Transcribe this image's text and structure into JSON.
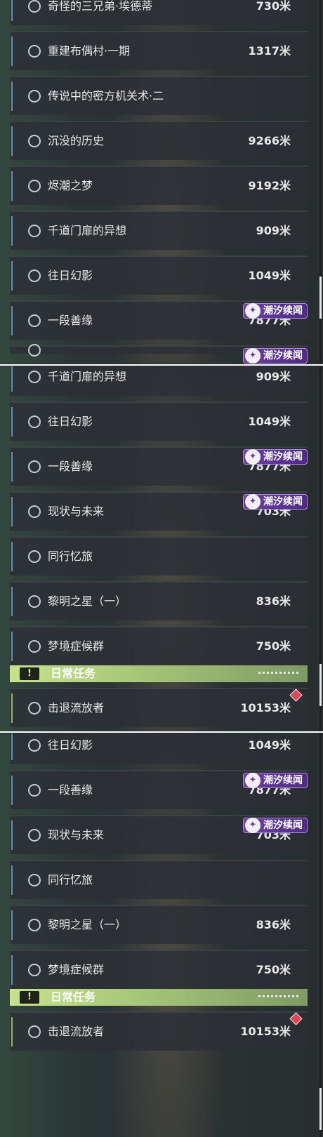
{
  "tag_label": "潮汐续闻",
  "daily_section": {
    "title": "日常任务",
    "badge": "!"
  },
  "panels": [
    {
      "rows": [
        {
          "name": "奇怪的三兄弟·埃德蒂",
          "distance": "730米",
          "tag": false,
          "partial": "top"
        },
        {
          "name": "重建布偶村·一期",
          "distance": "1317米",
          "tag": false
        },
        {
          "name": "传说中的密方机关术·二",
          "distance": "",
          "tag": false
        },
        {
          "name": "沉没的历史",
          "distance": "9266米",
          "tag": false
        },
        {
          "name": "烬潮之梦",
          "distance": "9192米",
          "tag": false
        },
        {
          "name": "千道门扉的异想",
          "distance": "909米",
          "tag": false
        },
        {
          "name": "往日幻影",
          "distance": "1049米",
          "tag": false
        },
        {
          "name": "一段善缘",
          "distance": "7877米",
          "tag": true
        },
        {
          "name": "",
          "distance": "",
          "tag": true,
          "partial": "bottom"
        }
      ],
      "scroll_position": 0.86
    },
    {
      "rows": [
        {
          "name": "千道门扉的异想",
          "distance": "909米",
          "tag": false
        },
        {
          "name": "往日幻影",
          "distance": "1049米",
          "tag": false
        },
        {
          "name": "一段善缘",
          "distance": "7877米",
          "tag": true
        },
        {
          "name": "现状与未来",
          "distance": "703米",
          "tag": true
        },
        {
          "name": "同行忆旅",
          "distance": "",
          "tag": false
        },
        {
          "name": "黎明之星（一）",
          "distance": "836米",
          "tag": false
        },
        {
          "name": "梦境症候群",
          "distance": "750米",
          "tag": false
        }
      ],
      "daily_rows": [
        {
          "name": "击退流放者",
          "distance": "10153米"
        }
      ],
      "scroll_position": 0.92
    },
    {
      "rows": [
        {
          "name": "往日幻影",
          "distance": "1049米",
          "tag": false
        },
        {
          "name": "一段善缘",
          "distance": "7877米",
          "tag": true
        },
        {
          "name": "现状与未来",
          "distance": "703米",
          "tag": true
        },
        {
          "name": "同行忆旅",
          "distance": "",
          "tag": false
        },
        {
          "name": "黎明之星（一）",
          "distance": "836米",
          "tag": false
        },
        {
          "name": "梦境症候群",
          "distance": "750米",
          "tag": false
        }
      ],
      "daily_rows": [
        {
          "name": "击退流放者",
          "distance": "10153米"
        }
      ],
      "scroll_position": 0.98
    }
  ]
}
